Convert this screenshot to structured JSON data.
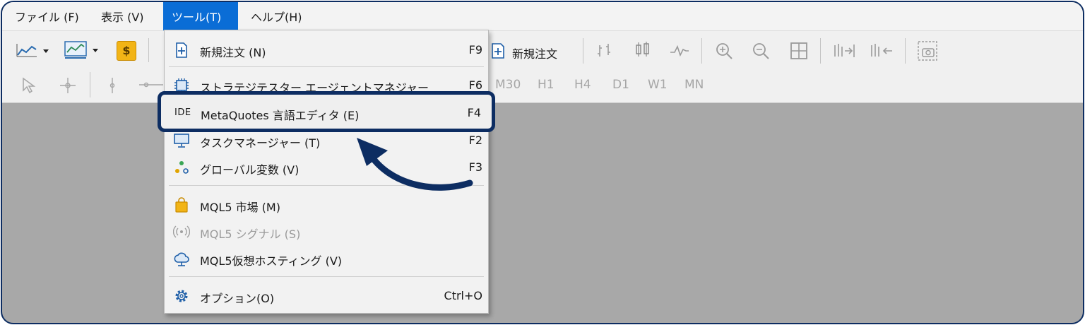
{
  "menubar": {
    "items": [
      {
        "label": "ファイル (F)"
      },
      {
        "label": "表示 (V)"
      },
      {
        "label": "ツール(T)"
      },
      {
        "label": "ヘルプ(H)"
      }
    ]
  },
  "toolbar": {
    "new_order_label": "新規注文",
    "timeframes": [
      "M30",
      "H1",
      "H4",
      "D1",
      "W1",
      "MN"
    ]
  },
  "tools_menu": {
    "items": [
      {
        "label": "新規注文 (N)",
        "shortcut": "F9",
        "icon": "new-order-icon"
      },
      {
        "label": "ストラテジテスター エージェントマネジャー",
        "shortcut": "F6",
        "icon": "chip-icon"
      },
      {
        "label": "MetaQuotes 言語エディタ (E)",
        "shortcut": "F4",
        "icon": "ide-icon",
        "icon_text": "IDE"
      },
      {
        "label": "タスクマネージャー (T)",
        "shortcut": "F2",
        "icon": "monitor-icon"
      },
      {
        "label": "グローバル変数 (V)",
        "shortcut": "F3",
        "icon": "global-vars-icon"
      },
      {
        "label": "MQL5 市場 (M)",
        "shortcut": "",
        "icon": "shopping-bag-icon"
      },
      {
        "label": "MQL5 シグナル (S)",
        "shortcut": "",
        "icon": "signal-icon"
      },
      {
        "label": "MQL5仮想ホスティング (V)",
        "shortcut": "",
        "icon": "cloud-icon"
      },
      {
        "label": "オプション(O)",
        "shortcut": "Ctrl+O",
        "icon": "gear-icon"
      }
    ]
  },
  "colors": {
    "accent": "#0d2d62",
    "menu_active": "#0a6dd6",
    "background": "#a8a8a8"
  }
}
